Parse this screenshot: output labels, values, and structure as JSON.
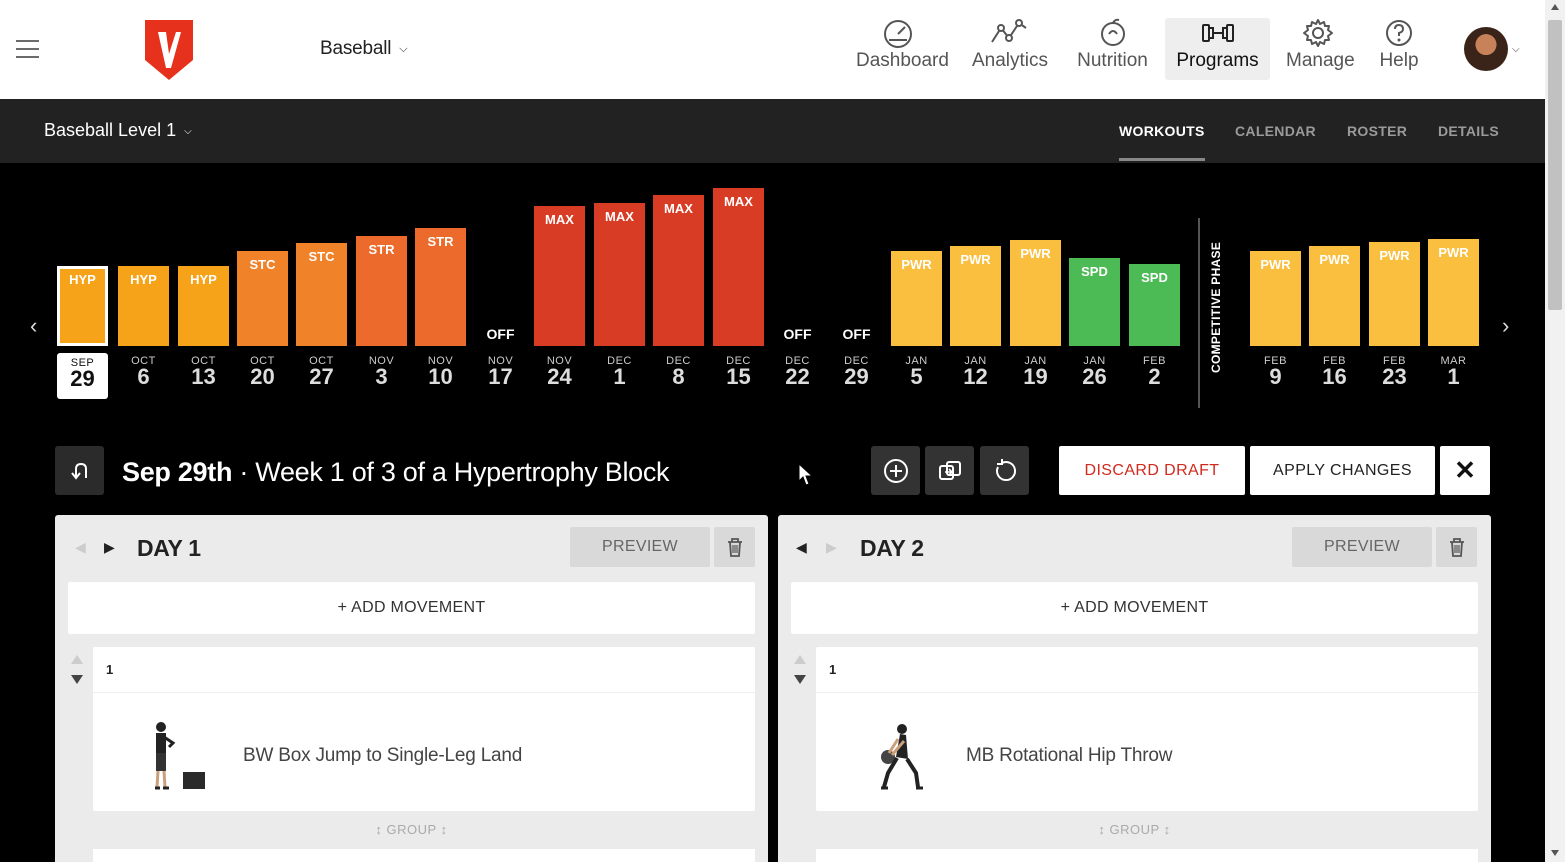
{
  "colors": {
    "hyp": "#f6a31a",
    "stc": "#f0832a",
    "str": "#ec6a2b",
    "max": "#d93c25",
    "pwr": "#fbbf3f",
    "spd": "#4cba55",
    "discard": "#d12a1f"
  },
  "topnav": {
    "sport": "Baseball",
    "items": [
      {
        "label": "Dashboard",
        "icon": "speedometer-icon"
      },
      {
        "label": "Analytics",
        "icon": "trend-line-icon"
      },
      {
        "label": "Nutrition",
        "icon": "apple-icon"
      },
      {
        "label": "Programs",
        "icon": "dumbbell-icon",
        "active": true
      },
      {
        "label": "Manage",
        "icon": "gear-icon"
      },
      {
        "label": "Help",
        "icon": "question-icon"
      }
    ]
  },
  "subnav": {
    "program": "Baseball Level 1",
    "tabs": [
      "WORKOUTS",
      "CALENDAR",
      "ROSTER",
      "DETAILS"
    ],
    "active_tab": "WORKOUTS"
  },
  "timeline": {
    "phase_label": "COMPETITIVE PHASE",
    "weeks": [
      {
        "label": "HYP",
        "type": "hyp",
        "level": 3,
        "month": "SEP",
        "day": "29",
        "selected": true
      },
      {
        "label": "HYP",
        "type": "hyp",
        "level": 3,
        "month": "OCT",
        "day": "6"
      },
      {
        "label": "HYP",
        "type": "hyp",
        "level": 3,
        "month": "OCT",
        "day": "13"
      },
      {
        "label": "STC",
        "type": "stc",
        "level": 4,
        "month": "OCT",
        "day": "20"
      },
      {
        "label": "STC",
        "type": "stc",
        "level": 4.5,
        "month": "OCT",
        "day": "27"
      },
      {
        "label": "STR",
        "type": "str",
        "level": 5,
        "month": "NOV",
        "day": "3"
      },
      {
        "label": "STR",
        "type": "str",
        "level": 5.5,
        "month": "NOV",
        "day": "10"
      },
      {
        "label": "OFF",
        "type": "off",
        "level": 0,
        "month": "NOV",
        "day": "17"
      },
      {
        "label": "MAX",
        "type": "max",
        "level": 7,
        "month": "NOV",
        "day": "24"
      },
      {
        "label": "MAX",
        "type": "max",
        "level": 7.2,
        "month": "DEC",
        "day": "1"
      },
      {
        "label": "MAX",
        "type": "max",
        "level": 7.7,
        "month": "DEC",
        "day": "8"
      },
      {
        "label": "MAX",
        "type": "max",
        "level": 8.2,
        "month": "DEC",
        "day": "15"
      },
      {
        "label": "OFF",
        "type": "off",
        "level": 0,
        "month": "DEC",
        "day": "22"
      },
      {
        "label": "OFF",
        "type": "off",
        "level": 0,
        "month": "DEC",
        "day": "29"
      },
      {
        "label": "PWR",
        "type": "pwr",
        "level": 4,
        "month": "JAN",
        "day": "5"
      },
      {
        "label": "PWR",
        "type": "pwr",
        "level": 4.3,
        "month": "JAN",
        "day": "12"
      },
      {
        "label": "PWR",
        "type": "pwr",
        "level": 4.7,
        "month": "JAN",
        "day": "19"
      },
      {
        "label": "SPD",
        "type": "spd",
        "level": 3.5,
        "month": "JAN",
        "day": "26"
      },
      {
        "label": "SPD",
        "type": "spd",
        "level": 3.1,
        "month": "FEB",
        "day": "2"
      },
      {
        "label": "PWR",
        "type": "pwr",
        "level": 4,
        "month": "FEB",
        "day": "9"
      },
      {
        "label": "PWR",
        "type": "pwr",
        "level": 4.3,
        "month": "FEB",
        "day": "16"
      },
      {
        "label": "PWR",
        "type": "pwr",
        "level": 4.6,
        "month": "FEB",
        "day": "23"
      },
      {
        "label": "PWR",
        "type": "pwr",
        "level": 4.8,
        "month": "MAR",
        "day": "1"
      }
    ]
  },
  "week_header": {
    "date": "Sep 29th",
    "separator": "·",
    "desc": "Week 1 of 3 of a Hypertrophy Block",
    "discard": "DISCARD DRAFT",
    "apply": "APPLY CHANGES"
  },
  "days": [
    {
      "title": "DAY 1",
      "preview": "PREVIEW",
      "add": "+ ADD MOVEMENT",
      "num": "1",
      "movement": "BW Box Jump to Single-Leg Land",
      "group": "GROUP"
    },
    {
      "title": "DAY 2",
      "preview": "PREVIEW",
      "add": "+ ADD MOVEMENT",
      "num": "1",
      "movement": "MB Rotational Hip Throw",
      "group": "GROUP"
    }
  ]
}
